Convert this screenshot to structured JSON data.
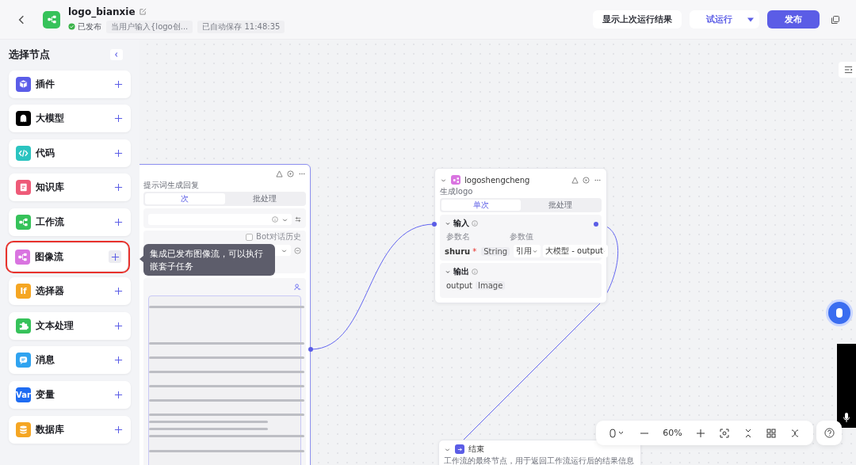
{
  "header": {
    "title": "logo_bianxie",
    "status": "已发布",
    "description": "当用户输入{logo创...",
    "autosave": "已自动保存 11:48:35",
    "buttons": [
      {
        "label": "显示上次运行结果",
        "kind": "default"
      },
      {
        "label": "试运行",
        "kind": "split"
      },
      {
        "label": "发布",
        "kind": "primary"
      }
    ]
  },
  "sidebar": {
    "title": "选择节点",
    "items": [
      {
        "label": "插件",
        "kind": "plugin",
        "color": "#5a5de8",
        "selected": false
      },
      {
        "label": "大模型",
        "kind": "llm",
        "color": "#000000",
        "selected": false
      },
      {
        "label": "代码",
        "kind": "code",
        "color": "#2bc4c0",
        "selected": false
      },
      {
        "label": "知识库",
        "kind": "book",
        "color": "#ee5a78",
        "selected": false
      },
      {
        "label": "工作流",
        "kind": "flow",
        "color": "#36c25a",
        "selected": false
      },
      {
        "label": "图像流",
        "kind": "flow",
        "color": "#d974e0",
        "selected": true
      },
      {
        "label": "选择器",
        "kind": "text",
        "icon_text": "If",
        "color": "#f5a623",
        "selected": false
      },
      {
        "label": "文本处理",
        "kind": "puzzle",
        "color": "#36c25a",
        "selected": false
      },
      {
        "label": "消息",
        "kind": "message",
        "color": "#2fa3f0",
        "selected": false
      },
      {
        "label": "变量",
        "kind": "text",
        "icon_text": "Var",
        "color": "#1f6cf2",
        "selected": false
      },
      {
        "label": "数据库",
        "kind": "database",
        "color": "#f5a623",
        "selected": false
      }
    ]
  },
  "tooltip": {
    "text": "集成已发布图像流，可以执行嵌套子任务"
  },
  "llm_node": {
    "description": "提示词生成回复",
    "tabs": [
      {
        "label": "次",
        "selected": true
      },
      {
        "label": "批处理",
        "selected": false
      }
    ],
    "history_label": "Bot对话历史",
    "history_checked": false
  },
  "image_node": {
    "title": "logoshengcheng",
    "description": "生成logo",
    "tabs": [
      {
        "label": "单次",
        "selected": true
      },
      {
        "label": "批处理",
        "selected": false
      }
    ],
    "input": {
      "title": "输入",
      "name_header": "参数名",
      "value_header": "参数值",
      "param": "shuru",
      "required_mark": "*",
      "type": "String",
      "source": "引用",
      "value": "大模型 - output"
    },
    "output": {
      "title": "输出",
      "param": "output",
      "type": "Image"
    }
  },
  "end_node": {
    "title": "结束",
    "description": "工作流的最终节点，用于返回工作流运行后的结果信息"
  },
  "toolbar": {
    "zoom": "60%"
  }
}
